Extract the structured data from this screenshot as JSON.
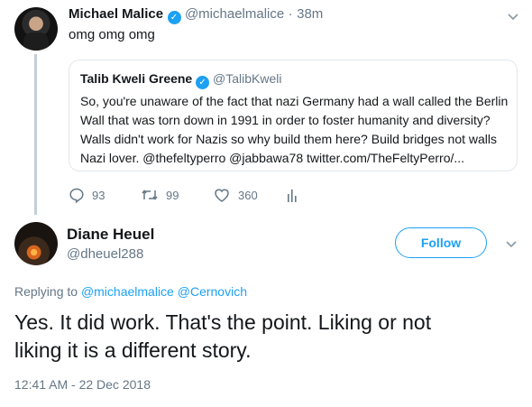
{
  "parent_tweet": {
    "author_name": "Michael Malice",
    "author_handle": "@michaelmalice",
    "separator": "·",
    "time": "38m",
    "text": "omg omg omg",
    "verified_icon": "verified-badge-icon"
  },
  "quoted_tweet": {
    "author_name": "Talib Kweli Greene",
    "author_handle": "@TalibKweli",
    "lines": [
      "So, you're unaware of the fact that nazi Germany had a wall called the Berlin",
      "Wall that was torn down in 1991 in order to foster humanity and diversity?",
      "Walls didn't work for Nazis so why build them here? Build bridges not walls",
      "Nazi lover. @thefeltyperro @jabbawa78 twitter.com/TheFeltyPerro/..."
    ]
  },
  "actions": {
    "reply_count": "93",
    "retweet_count": "99",
    "like_count": "360"
  },
  "main_tweet": {
    "author_name": "Diane Heuel",
    "author_handle": "@dheuel288",
    "follow_label": "Follow",
    "replying_prefix": "Replying to",
    "replying_to_1": "@michaelmalice",
    "replying_to_2": "@Cernovich",
    "text_line_1": "Yes. It did work. That's the point. Liking or not",
    "text_line_2": "liking it is a different story.",
    "timestamp": "12:41 AM - 22 Dec 2018"
  },
  "colors": {
    "accent": "#1da1f2",
    "secondary_text": "#657786",
    "border": "#e1e8ed"
  }
}
